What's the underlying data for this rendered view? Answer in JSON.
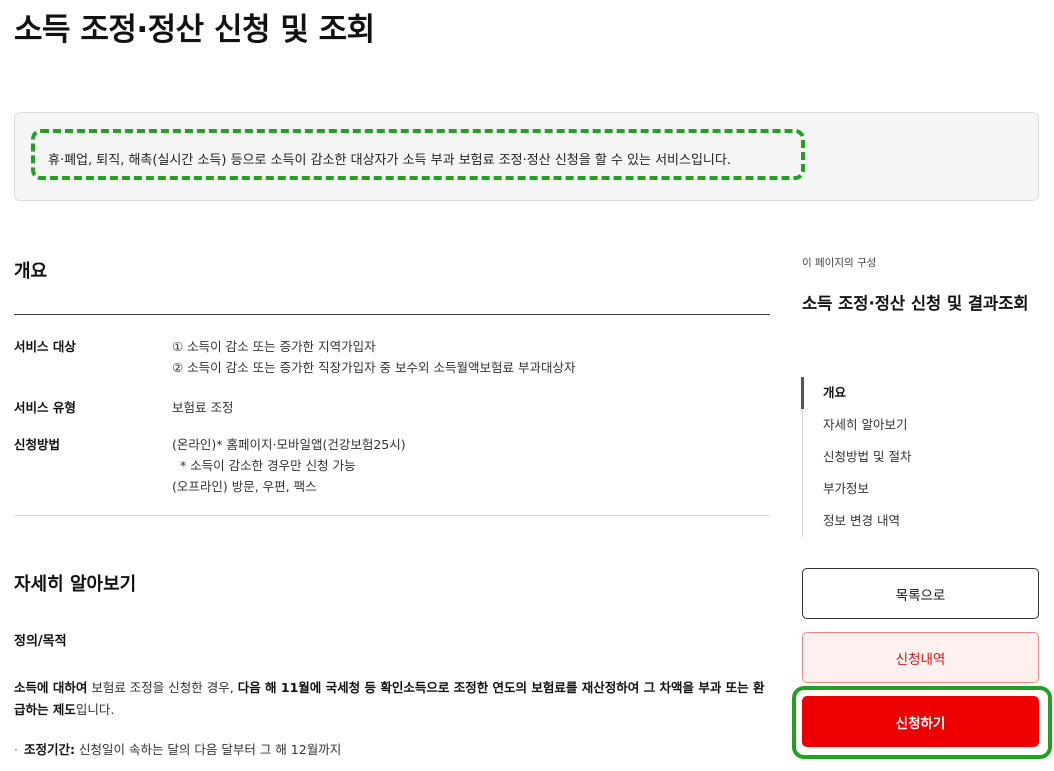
{
  "page": {
    "title": "소득 조정·정산 신청 및 조회",
    "intro": "휴·폐업, 퇴직, 해촉(실시간 소득) 등으로 소득이 감소한 대상자가 소득 부과 보험료 조정·정산 신청을 할 수 있는 서비스입니다."
  },
  "overview": {
    "heading": "개요",
    "rows": [
      {
        "label": "서비스 대상",
        "lines": [
          "① 소득이 감소 또는 증가한 지역가입자",
          "② 소득이 감소 또는 증가한 직장가입자 중 보수외 소득월액보험료 부과대상자"
        ]
      },
      {
        "label": "서비스 유형",
        "lines": [
          "보험료 조정"
        ]
      },
      {
        "label": "신청방법",
        "lines": [
          "(온라인)* 홈페이지·모바일앱(건강보험25시)",
          "  * 소득이 감소한 경우만 신청 가능",
          "(오프라인) 방문, 우편, 팩스"
        ]
      }
    ]
  },
  "details": {
    "heading": "자세히 알아보기",
    "subheading": "정의/목적",
    "para_b1": "소득에 대하여",
    "para_n1": " 보험료 조정을 신청한 경우, ",
    "para_b2": "다음 해 11월에 국세청 등 확인소득으로 조정한 연도의 보험료를 재산정하여 그 차액을 부과 또는 환급하는 제도",
    "para_n2": "입니다.",
    "bullet_label": "조정기간:",
    "bullet_text": " 신청일이 속하는 달의 다음 달부터 그 해 12월까지"
  },
  "aside": {
    "caption": "이 페이지의 구성",
    "title": "소득 조정·정산 신청 및 결과조회",
    "toc": [
      "개요",
      "자세히 알아보기",
      "신청방법 및 절차",
      "부가정보",
      "정보 변경 내역"
    ],
    "toc_active_index": 0,
    "buttons": {
      "list": "목록으로",
      "history": "신청내역",
      "apply": "신청하기"
    }
  },
  "colors": {
    "highlight": "#22a022",
    "apply_button": "#ee0000",
    "history_button_text": "#d81818"
  }
}
